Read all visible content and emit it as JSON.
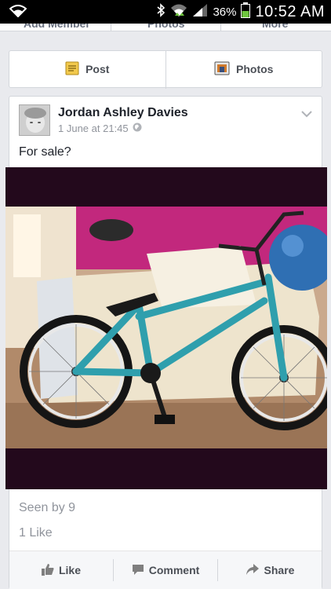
{
  "status_bar": {
    "battery_percent": "36%",
    "time": "10:52 AM",
    "icons": [
      "wifi-icon",
      "bluetooth-icon",
      "wifi-signal-icon",
      "cell-signal-icon",
      "battery-icon"
    ]
  },
  "top_tabs": [
    "Add Member",
    "Photos",
    "More"
  ],
  "composer": {
    "post_label": "Post",
    "photos_label": "Photos"
  },
  "post": {
    "author": "Jordan Ashley Davies",
    "timestamp": "1 June at 21:45",
    "text": "For sale?",
    "seen_by": "Seen by 9",
    "likes": "1 Like"
  },
  "actions": {
    "like_label": "Like",
    "comment_label": "Comment",
    "share_label": "Share"
  },
  "colors": {
    "accent_green": "#6ec53e",
    "bike_teal": "#2f9fad",
    "photo_frame": "#23091c"
  }
}
